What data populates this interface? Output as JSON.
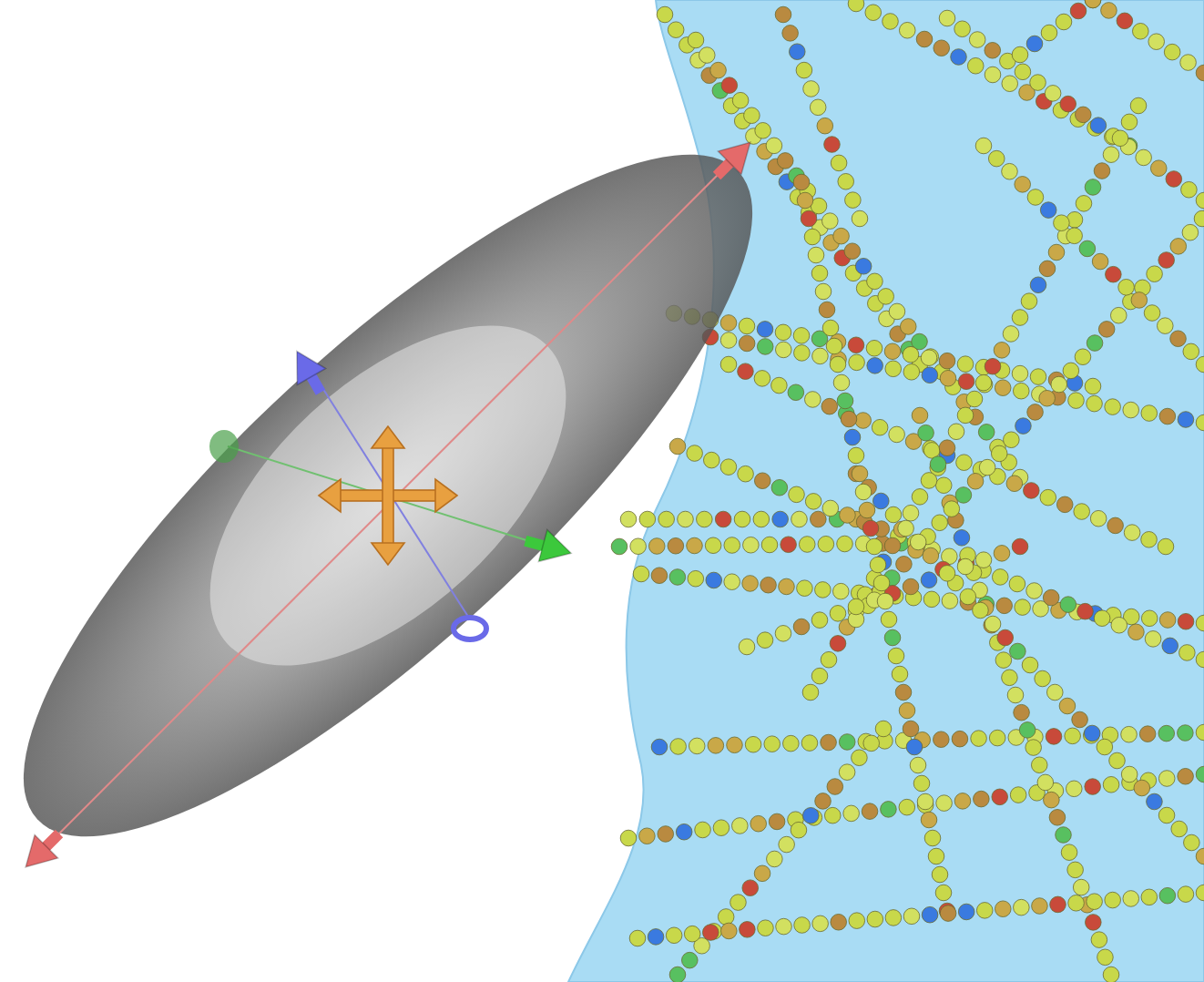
{
  "viewport": {
    "kind": "scene",
    "gizmo": {
      "kind": "ellipsoid"
    }
  }
}
